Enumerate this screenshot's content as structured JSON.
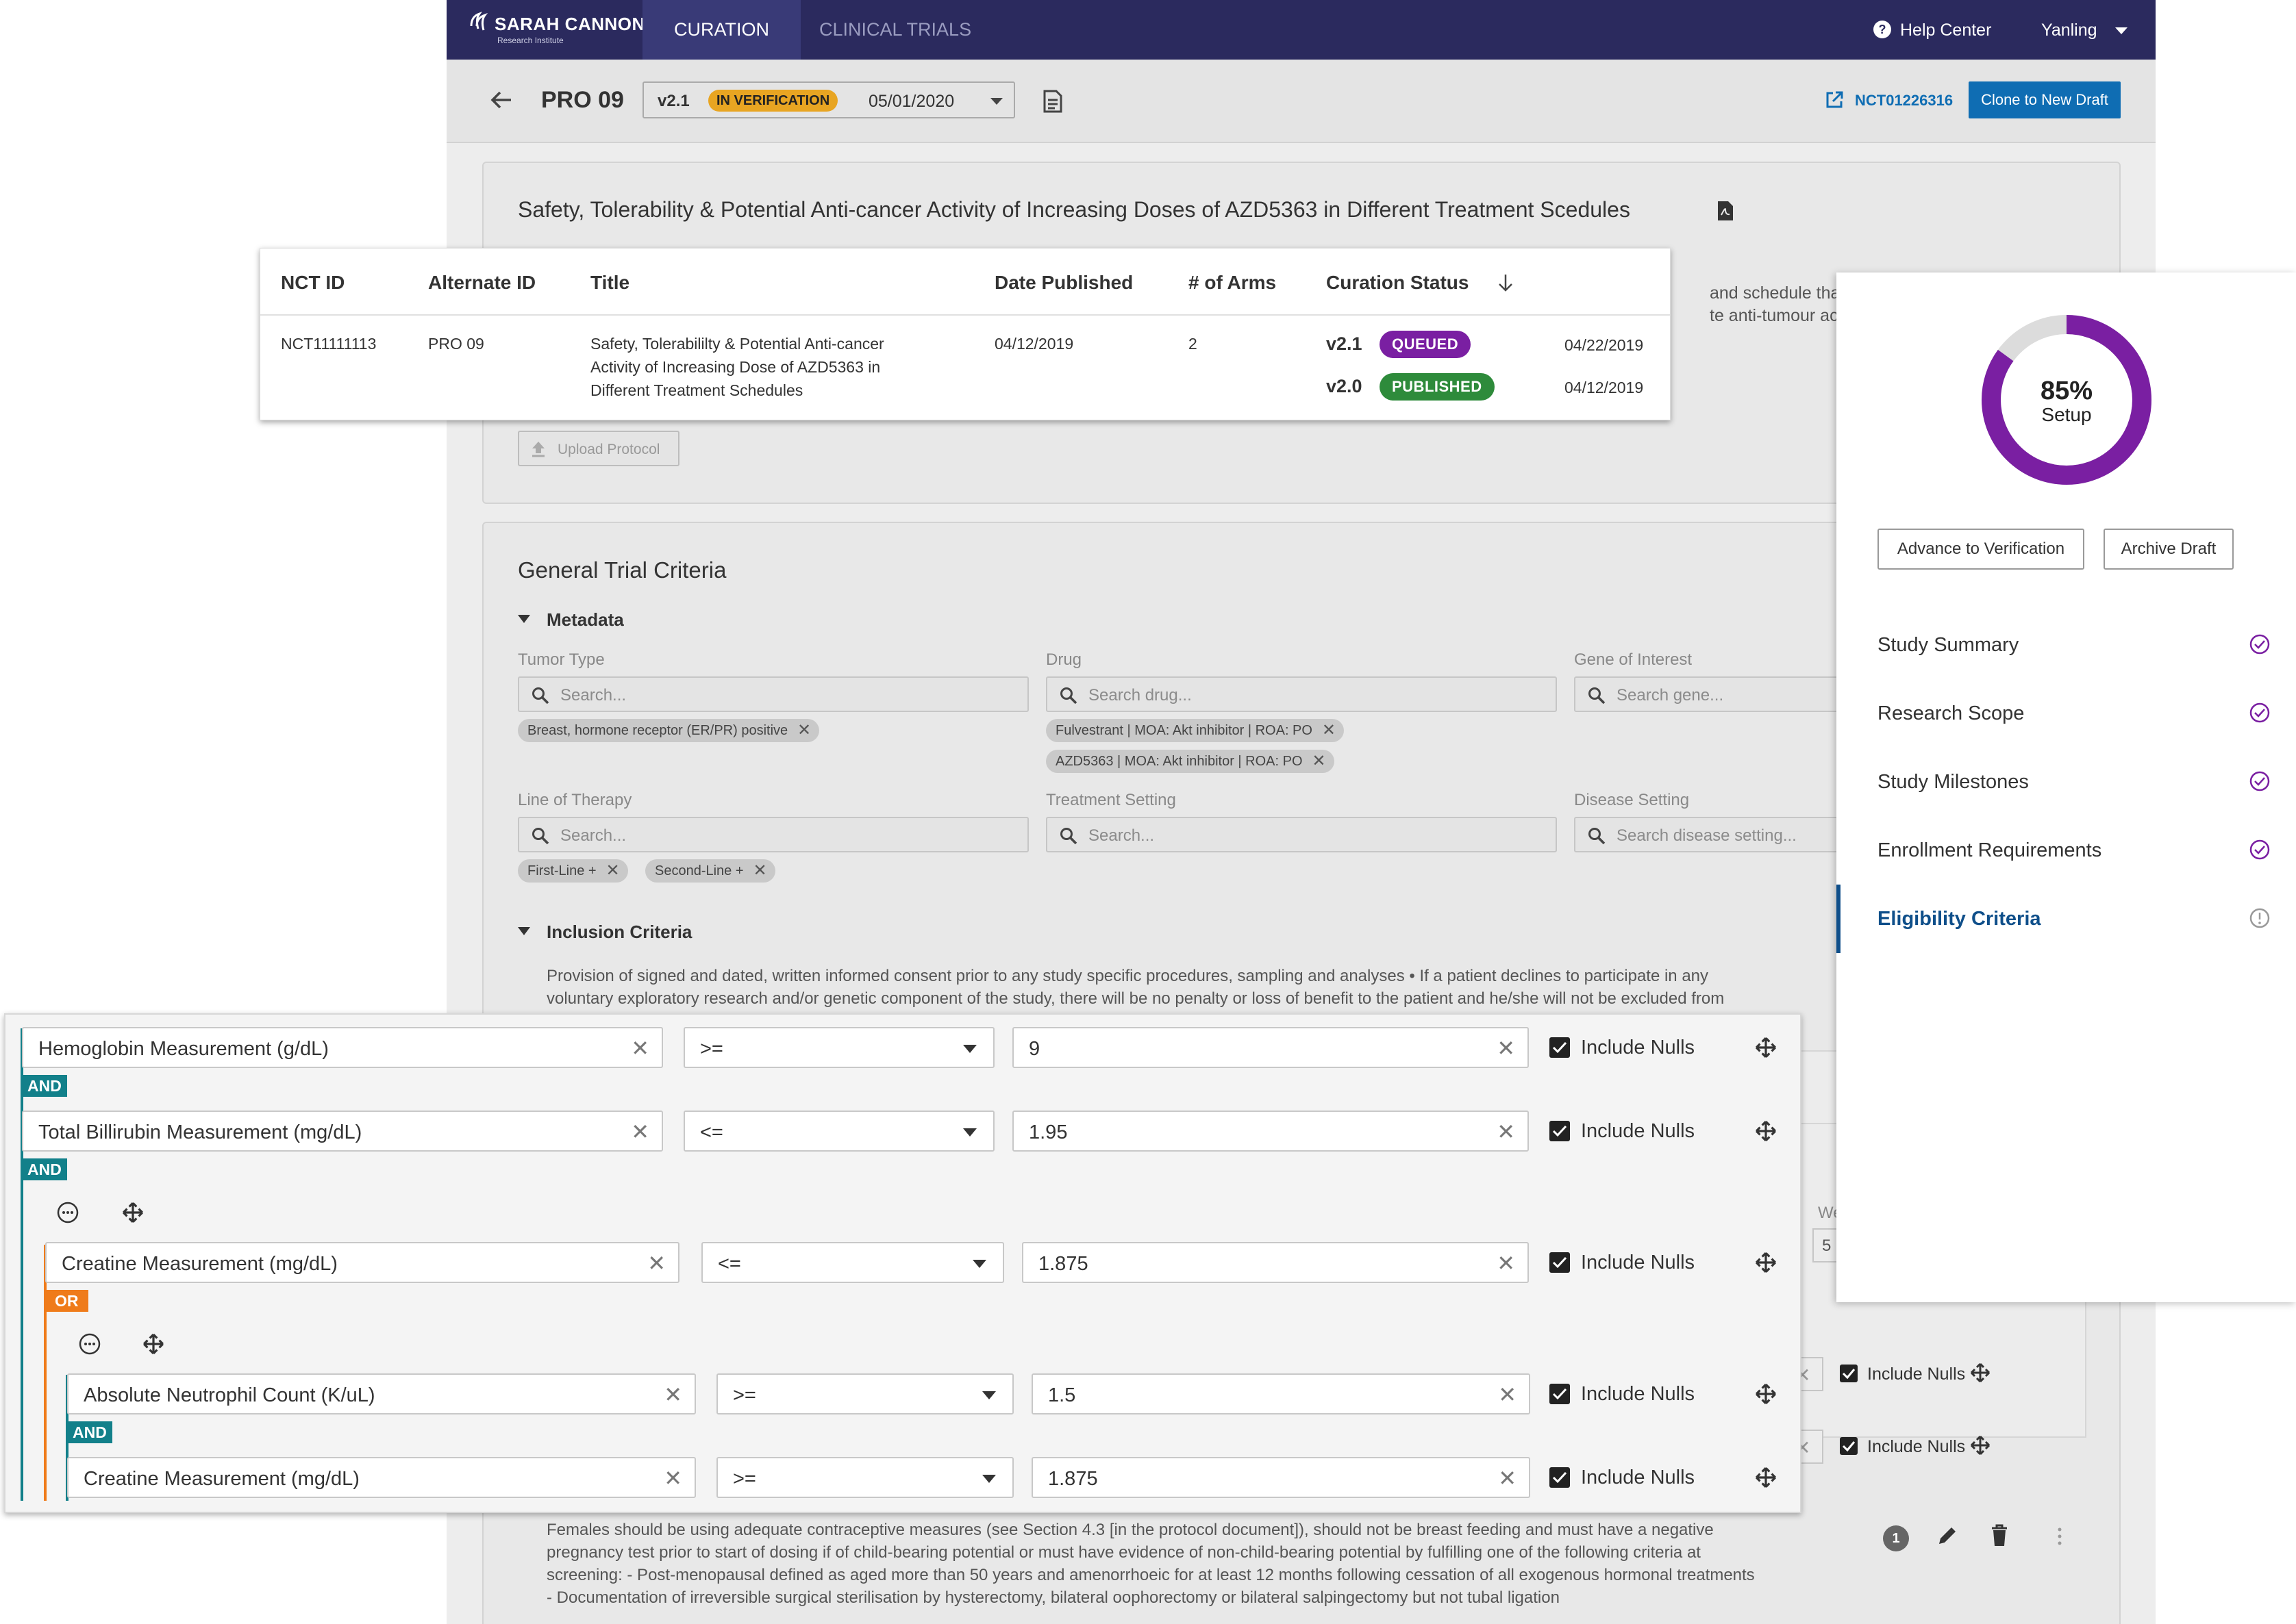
{
  "topnav": {
    "logo_main": "SARAH CANNON",
    "logo_sub": "Research Institute",
    "tabs": [
      "CURATION",
      "CLINICAL TRIALS"
    ],
    "help": "Help Center",
    "user": "Yanling"
  },
  "subheader": {
    "title": "PRO 09",
    "version": "v2.1",
    "status": "IN VERIFICATION",
    "date": "05/01/2020",
    "nct_link": "NCT01226316",
    "clone_button": "Clone to New Draft"
  },
  "summary_card": {
    "title": "Safety, Tolerability & Potential Anti-cancer Activity of Increasing Doses of AZD5363 in Different Treatment Scedules",
    "text_line1": "and schedule that ca",
    "text_line2": "te anti-tumour activit",
    "upload_button": "Upload Protocol"
  },
  "trial_table": {
    "headers": [
      "NCT ID",
      "Alternate ID",
      "Title",
      "Date Published",
      "# of Arms",
      "Curation Status"
    ],
    "row": {
      "nct_id": "NCT11111113",
      "alt_id": "PRO 09",
      "title_lines": [
        "Safety, Tolerabililty & Potential Anti-cancer",
        "Activity of Increasing Dose of AZD5363 in",
        "Different Treatment Schedules"
      ],
      "date_published": "04/12/2019",
      "arms": "2",
      "versions": [
        {
          "version": "v2.1",
          "status": "QUEUED",
          "date": "04/22/2019",
          "color": "#7a1fa2"
        },
        {
          "version": "v2.0",
          "status": "PUBLISHED",
          "date": "04/12/2019",
          "color": "#2e8b3b"
        }
      ]
    }
  },
  "criteria": {
    "title": "General Trial Criteria",
    "metadata_label": "Metadata",
    "tumor_type": {
      "label": "Tumor Type",
      "placeholder": "Search...",
      "chips": [
        "Breast, hormone receptor (ER/PR) positive"
      ]
    },
    "drug": {
      "label": "Drug",
      "placeholder": "Search drug...",
      "chips": [
        "Fulvestrant | MOA: Akt inhibitor | ROA: PO",
        "AZD5363 | MOA: Akt inhibitor | ROA: PO"
      ]
    },
    "gene": {
      "label": "Gene of Interest",
      "placeholder": "Search gene..."
    },
    "line_of_therapy": {
      "label": "Line of Therapy",
      "placeholder": "Search...",
      "chips": [
        "First-Line +",
        "Second-Line +"
      ]
    },
    "treatment_setting": {
      "label": "Treatment Setting",
      "placeholder": "Search..."
    },
    "disease_setting": {
      "label": "Disease Setting",
      "placeholder": "Search disease setting..."
    },
    "inclusion_label": "Inclusion Criteria",
    "inclusion_line1": "Provision of signed and dated, written informed consent prior to any study specific procedures, sampling and analyses • If a patient declines to participate in any",
    "inclusion_line2": "voluntary exploratory research and/or genetic component of the study, there will be no penalty or loss of benefit to the patient and he/she will not be excluded from",
    "weight_label": "Wei",
    "weight_value": "5",
    "bg_rows": [
      {
        "label": "Include Nulls"
      },
      {
        "label": "Include Nulls"
      }
    ],
    "females_lines": [
      "Females should be using adequate contraceptive measures (see Section 4.3 [in the protocol document]), should not be breast feeding and must have a negative",
      "pregnancy test prior to start of dosing if of child-bearing potential or must have evidence of non-child-bearing potential by fulfilling one of the following criteria at",
      "screening: - Post-menopausal defined as aged more than 50 years and amenorrhoeic for at least 12 months following cessation of all exogenous hormonal treatments",
      "- Documentation of irreversible surgical sterilisation by hysterectomy, bilateral oophorectomy or bilateral salpingectomy but not tubal ligation"
    ],
    "females_count": "1"
  },
  "right_panel": {
    "progress_percent": 85,
    "progress_value": "85%",
    "progress_label": "Setup",
    "advance_button": "Advance to Verification",
    "archive_button": "Archive Draft",
    "nav": [
      {
        "label": "Study Summary",
        "state": "done"
      },
      {
        "label": "Research Scope",
        "state": "done"
      },
      {
        "label": "Study Milestones",
        "state": "done"
      },
      {
        "label": "Enrollment Requirements",
        "state": "done"
      },
      {
        "label": "Eligibility Criteria",
        "state": "active"
      }
    ]
  },
  "builder": {
    "include_nulls": "Include Nulls",
    "ops": [
      "AND",
      "AND",
      "OR",
      "AND"
    ],
    "rows": [
      {
        "field": "Hemoglobin Measurement (g/dL)",
        "operator": ">=",
        "value": "9"
      },
      {
        "field": "Total Billirubin Measurement (mg/dL)",
        "operator": "<=",
        "value": "1.95"
      },
      {
        "field": "Creatine Measurement (mg/dL)",
        "operator": "<=",
        "value": "1.875"
      },
      {
        "field": "Absolute Neutrophil Count (K/uL)",
        "operator": ">=",
        "value": "1.5"
      },
      {
        "field": "Creatine Measurement (mg/dL)",
        "operator": ">=",
        "value": "1.875"
      }
    ]
  },
  "colors": {
    "nav_bg": "#2b2a5e",
    "accent_purple": "#7a1fa2",
    "teal": "#12808a",
    "orange": "#ef7b1a",
    "link_blue": "#0f6db3"
  }
}
